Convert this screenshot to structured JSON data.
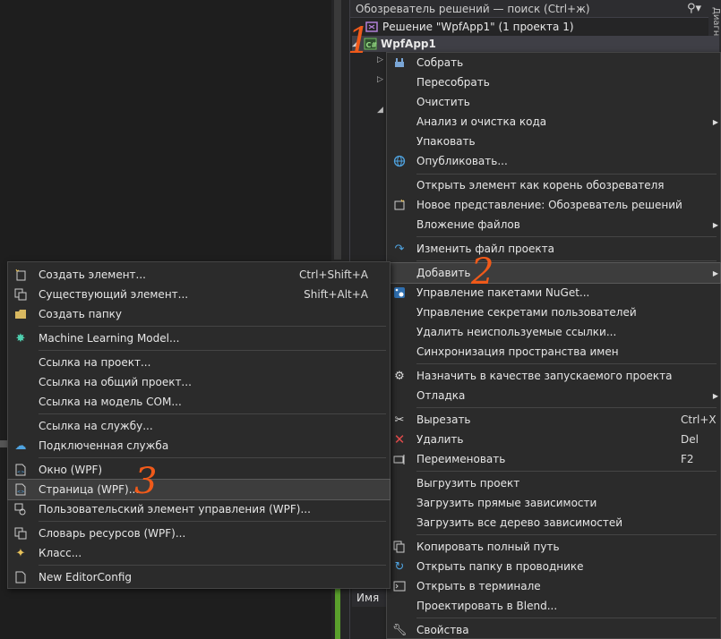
{
  "solution_panel": {
    "search_placeholder": "Обозреватель решений — поиск (Ctrl+ж)",
    "side_tab": "Диагности",
    "solution_label": "Решение \"WpfApp1\"  (1 проекта 1)",
    "project_label": "WpfApp1",
    "name_header": "Имя"
  },
  "annotations": {
    "one": "1",
    "two": "2",
    "three": "3"
  },
  "main_menu": {
    "items": [
      {
        "label": "Собрать",
        "icon": "build-icon"
      },
      {
        "label": "Пересобрать"
      },
      {
        "label": "Очистить"
      },
      {
        "label": "Анализ и очистка кода",
        "submenu": true
      },
      {
        "label": "Упаковать"
      },
      {
        "label": "Опубликовать...",
        "icon": "globe-icon"
      },
      {
        "label": "Открыть элемент как корень обозревателя"
      },
      {
        "label": "Новое представление: Обозреватель решений",
        "icon": "new-view-icon"
      },
      {
        "label": "Вложение файлов",
        "submenu": true
      },
      {
        "label": "Изменить файл проекта",
        "icon": "edit-arrow-icon"
      },
      {
        "label": "Добавить",
        "submenu": true
      },
      {
        "label": "Управление пакетами NuGet...",
        "icon": "nuget-icon"
      },
      {
        "label": "Управление секретами пользователей"
      },
      {
        "label": "Удалить неиспользуемые ссылки..."
      },
      {
        "label": "Синхронизация пространства имен"
      },
      {
        "label": "Назначить в качестве запускаемого проекта",
        "icon": "gear-icon"
      },
      {
        "label": "Отладка",
        "submenu": true
      },
      {
        "label": "Вырезать",
        "shortcut": "Ctrl+X",
        "icon": "scissors-icon"
      },
      {
        "label": "Удалить",
        "shortcut": "Del",
        "icon": "delete-x-icon"
      },
      {
        "label": "Переименовать",
        "shortcut": "F2",
        "icon": "rename-icon"
      },
      {
        "label": "Выгрузить проект"
      },
      {
        "label": "Загрузить прямые зависимости"
      },
      {
        "label": "Загрузить все дерево зависимостей"
      },
      {
        "label": "Копировать полный путь",
        "icon": "copy-icon"
      },
      {
        "label": "Открыть папку в проводнике",
        "icon": "refresh-arrow-icon"
      },
      {
        "label": "Открыть в терминале",
        "icon": "terminal-icon"
      },
      {
        "label": "Проектировать в Blend..."
      },
      {
        "label": "Свойства",
        "icon": "wrench-icon"
      }
    ]
  },
  "sub_menu": {
    "items": [
      {
        "label": "Создать элемент...",
        "shortcut": "Ctrl+Shift+A",
        "icon": "new-item-icon"
      },
      {
        "label": "Существующий элемент...",
        "shortcut": "Shift+Alt+A",
        "icon": "existing-item-icon"
      },
      {
        "label": "Создать папку",
        "icon": "folder-icon"
      },
      {
        "label": "Machine Learning Model...",
        "icon": "ml-model-icon"
      },
      {
        "label": "Ссылка на проект..."
      },
      {
        "label": "Ссылка на общий проект..."
      },
      {
        "label": "Ссылка на модель COM..."
      },
      {
        "label": "Ссылка на службу..."
      },
      {
        "label": "Подключенная служба",
        "icon": "connected-service-icon"
      },
      {
        "label": "Окно (WPF)",
        "icon": "xaml-window-icon"
      },
      {
        "label": "Страница (WPF)...",
        "icon": "xaml-page-icon"
      },
      {
        "label": "Пользовательский элемент управления (WPF)...",
        "icon": "user-control-icon"
      },
      {
        "label": "Словарь ресурсов (WPF)...",
        "icon": "resource-dictionary-icon"
      },
      {
        "label": "Класс...",
        "icon": "class-icon"
      },
      {
        "label": "New EditorConfig",
        "icon": "editorconfig-icon"
      }
    ]
  }
}
